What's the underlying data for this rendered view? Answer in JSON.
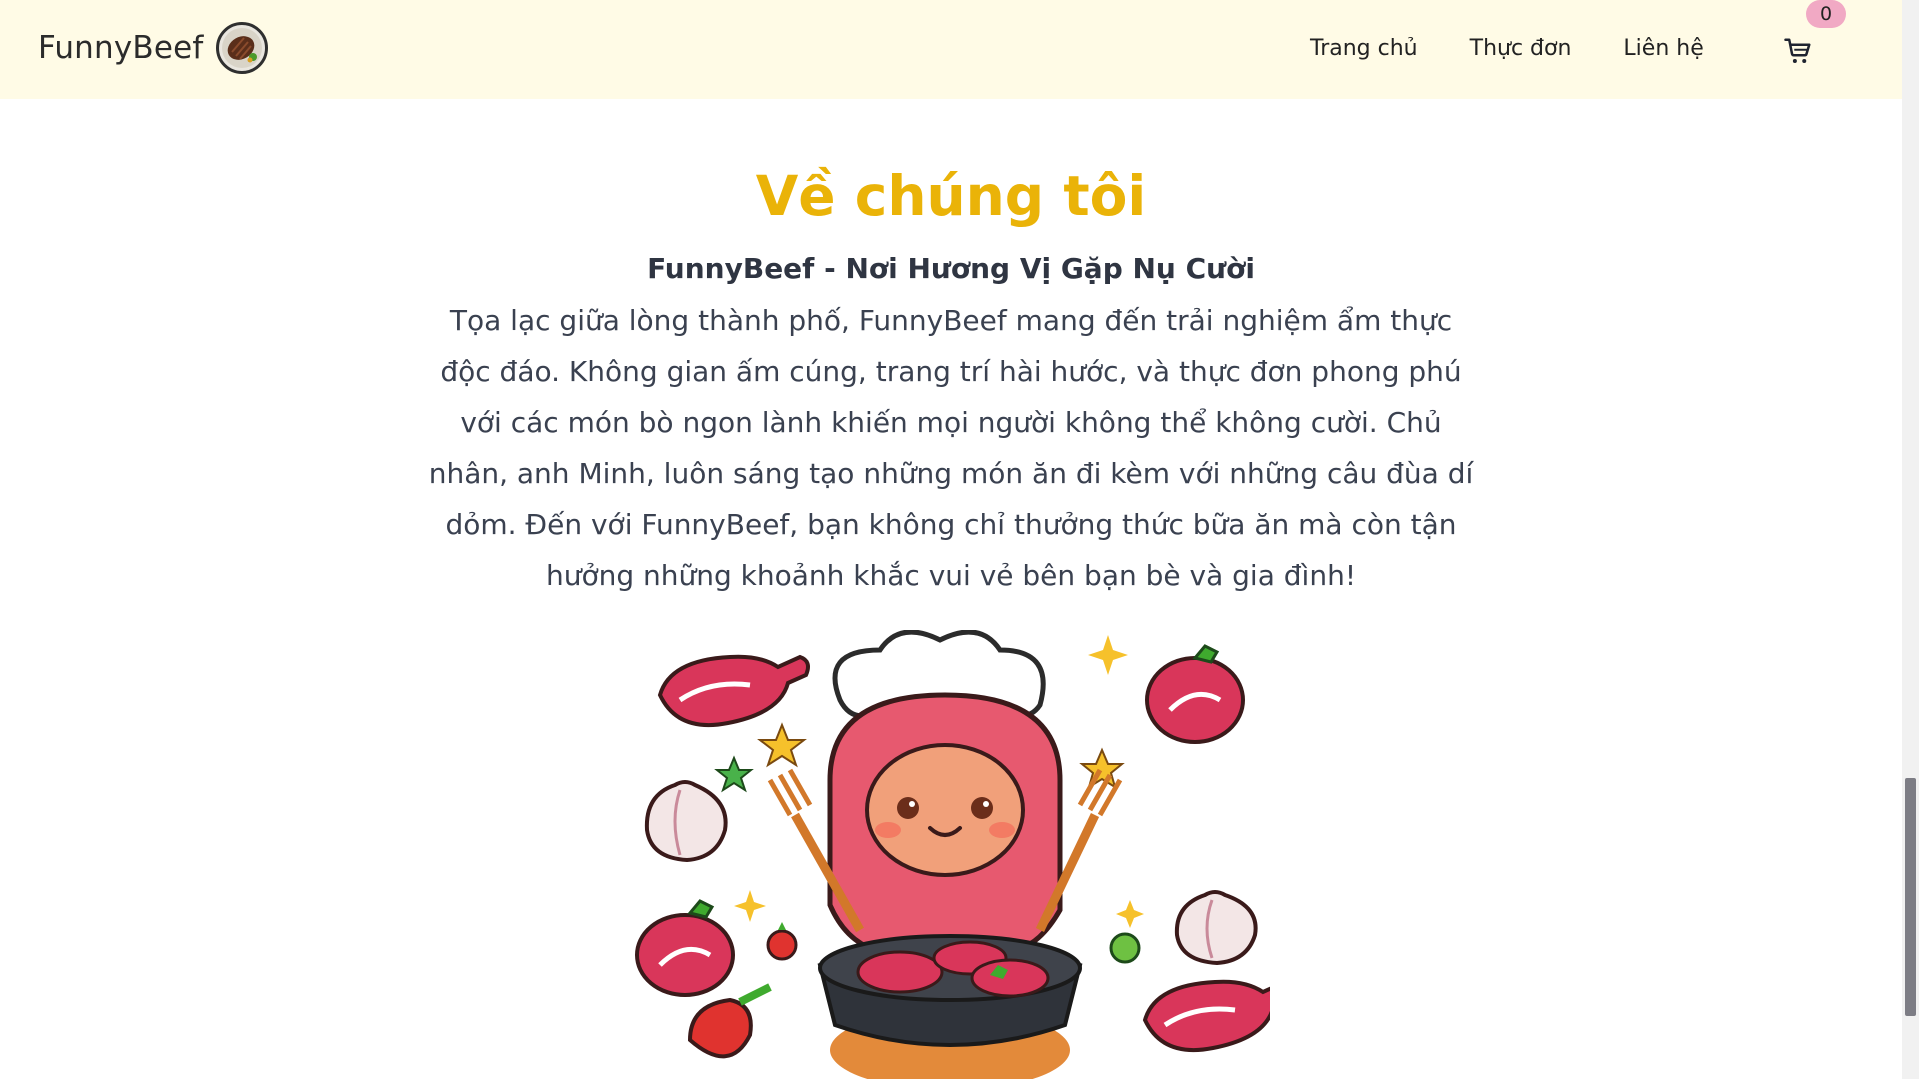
{
  "navbar": {
    "brand": "FunnyBeef",
    "links": [
      "Trang chủ",
      "Thực đơn",
      "Liên hệ"
    ],
    "cart_count": "0"
  },
  "about": {
    "title": "Về chúng tôi",
    "subtitle": "FunnyBeef - Nơi Hương Vị Gặp Nụ Cười",
    "body": "Tọa lạc giữa lòng thành phố, FunnyBeef mang đến trải nghiệm ẩm thực độc đáo. Không gian ấm cúng, trang trí hài hước, và thực đơn phong phú với các món bò ngon lành khiến mọi người không thể không cười. Chủ nhân, anh Minh, luôn sáng tạo những món ăn đi kèm với những câu đùa dí dỏm. Đến với FunnyBeef, bạn không chỉ thưởng thức bữa ăn mà còn tận hưởng những khoảnh khắc vui vẻ bên bạn bè và gia đình!"
  },
  "colors": {
    "navbar_bg": "#fffbe6",
    "title": "#eab308",
    "badge": "#f1a9c4"
  },
  "icons": {
    "cart": "cart-icon",
    "logo": "steak-plate-logo"
  }
}
